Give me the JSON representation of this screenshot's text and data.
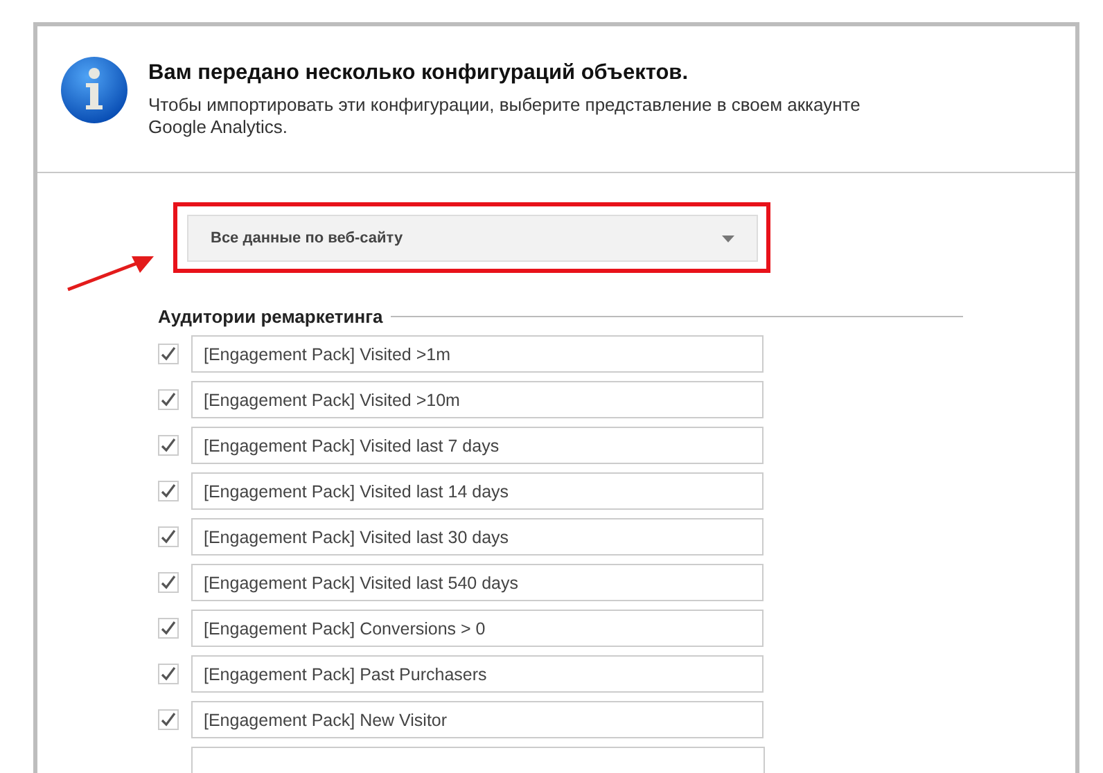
{
  "notice": {
    "title": "Вам передано несколько конфигураций объектов.",
    "text": "Чтобы импортировать эти конфигурации, выберите представление в своем аккаунте Google Analytics."
  },
  "view_select": {
    "value": "Все данные по веб-сайту"
  },
  "section": {
    "title": "Аудитории ремаркетинга"
  },
  "audiences": [
    {
      "name": "[Engagement Pack] Visited >1m",
      "checked": true
    },
    {
      "name": "[Engagement Pack] Visited >10m",
      "checked": true
    },
    {
      "name": "[Engagement Pack] Visited last 7 days",
      "checked": true
    },
    {
      "name": "[Engagement Pack] Visited last 14 days",
      "checked": true
    },
    {
      "name": "[Engagement Pack] Visited last 30 days",
      "checked": true
    },
    {
      "name": "[Engagement Pack] Visited last 540 days",
      "checked": true
    },
    {
      "name": "[Engagement Pack] Conversions > 0",
      "checked": true
    },
    {
      "name": "[Engagement Pack] Past Purchasers",
      "checked": true
    },
    {
      "name": "[Engagement Pack] New Visitor",
      "checked": true
    }
  ]
}
